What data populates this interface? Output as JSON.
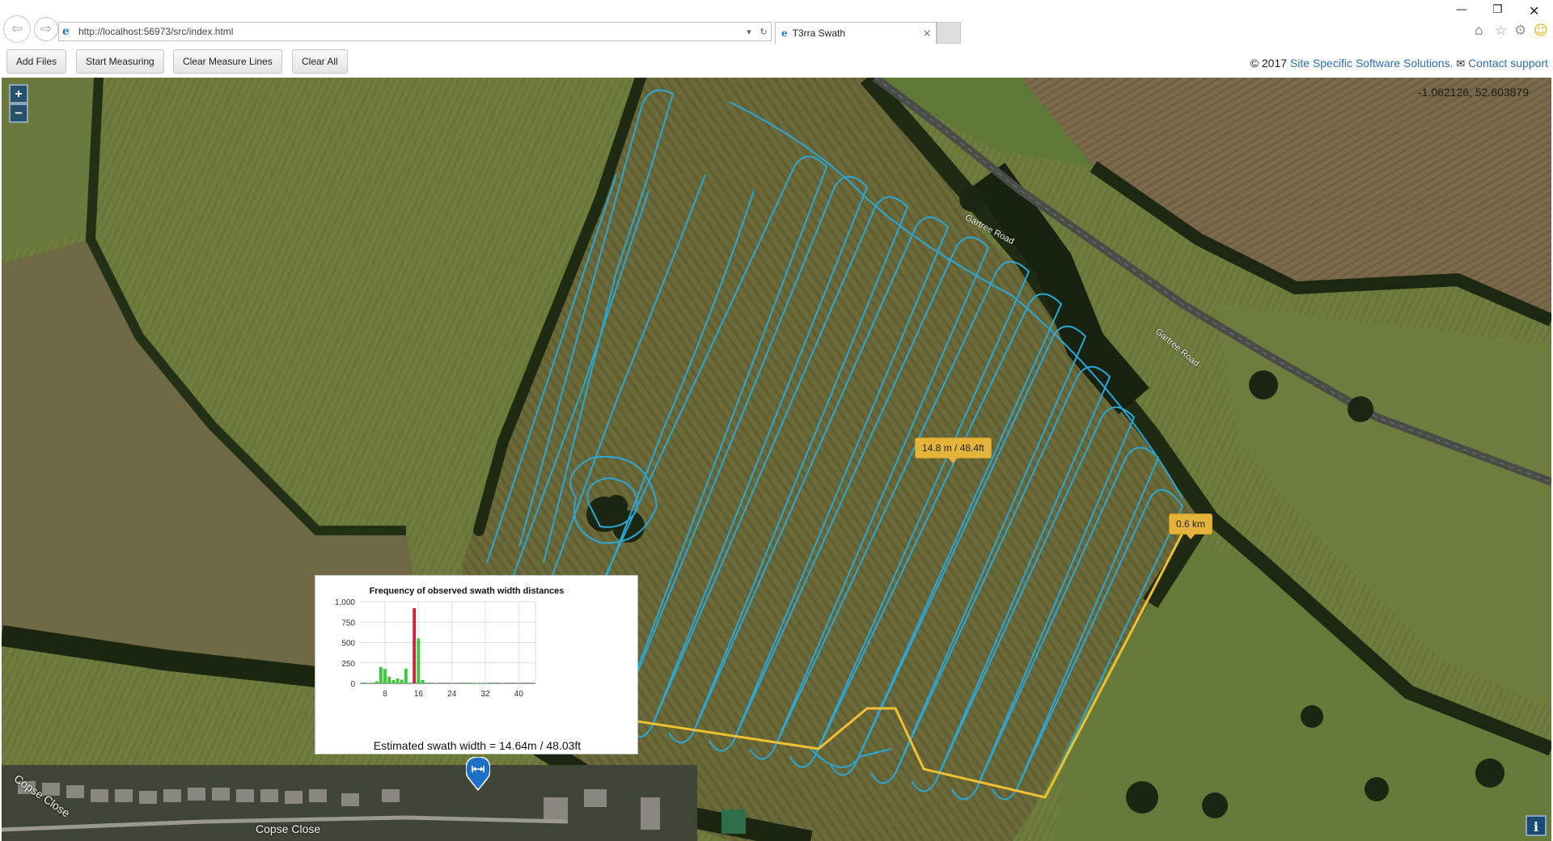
{
  "browser": {
    "url": "http://localhost:56973/src/index.html",
    "tab_title": "T3rra Swath",
    "close_tab": "×",
    "back_icon": "arrow-left-icon",
    "forward_icon": "arrow-right-icon"
  },
  "toolbar": {
    "add_files": "Add Files",
    "start_measuring": "Start Measuring",
    "clear_measure_lines": "Clear Measure Lines",
    "clear_all": "Clear All"
  },
  "credits": {
    "copyright": "© 2017",
    "company": "Site Specific Software Solutions.",
    "contact": "Contact support"
  },
  "map": {
    "zoom_in": "+",
    "zoom_out": "−",
    "coordinates": "-1.062126, 52.603879",
    "measure_tooltip": "14.8 m / 48.4ft",
    "distance_tooltip": "0.6 km",
    "road_label_1": "Gartree Road",
    "road_label_2": "Gartree Road",
    "street_label_1": "Copse Close",
    "street_label_2": "Copse Close",
    "info_button": "i",
    "swath_color": "#2aa8d8",
    "measure_color": "#f0c030"
  },
  "chart_panel": {
    "estimate": "Estimated swath width = 14.64m / 48.03ft"
  },
  "chart_data": {
    "type": "bar",
    "title": "Frequency of observed swath width distances",
    "xlabel": "",
    "ylabel": "",
    "x_ticks": [
      8,
      16,
      24,
      32,
      40
    ],
    "y_ticks": [
      0,
      250,
      500,
      750,
      1000
    ],
    "y_tick_labels": [
      "0",
      "250",
      "500",
      "750",
      "1,000"
    ],
    "xlim": [
      2,
      44
    ],
    "ylim": [
      0,
      1000
    ],
    "grid": true,
    "bars": [
      {
        "x": 3,
        "value": 10,
        "color": "#33cc33"
      },
      {
        "x": 4,
        "value": 5,
        "color": "#33cc33"
      },
      {
        "x": 6,
        "value": 25,
        "color": "#33cc33"
      },
      {
        "x": 7,
        "value": 200,
        "color": "#33cc33"
      },
      {
        "x": 8,
        "value": 175,
        "color": "#33cc33"
      },
      {
        "x": 9,
        "value": 80,
        "color": "#33cc33"
      },
      {
        "x": 10,
        "value": 40,
        "color": "#33cc33"
      },
      {
        "x": 11,
        "value": 60,
        "color": "#33cc33"
      },
      {
        "x": 12,
        "value": 45,
        "color": "#33cc33"
      },
      {
        "x": 13,
        "value": 180,
        "color": "#33cc33"
      },
      {
        "x": 14,
        "value": 10,
        "color": "#33cc33"
      },
      {
        "x": 15,
        "value": 920,
        "color": "#d0213f"
      },
      {
        "x": 16,
        "value": 550,
        "color": "#33cc33"
      },
      {
        "x": 17,
        "value": 40,
        "color": "#33cc33"
      },
      {
        "x": 18,
        "value": 8,
        "color": "#33cc33"
      },
      {
        "x": 20,
        "value": 5,
        "color": "#33cc33"
      },
      {
        "x": 29,
        "value": 6,
        "color": "#33cc33"
      },
      {
        "x": 30,
        "value": 5,
        "color": "#33cc33"
      },
      {
        "x": 31,
        "value": 6,
        "color": "#33cc33"
      },
      {
        "x": 32,
        "value": 5,
        "color": "#33cc33"
      },
      {
        "x": 36,
        "value": 4,
        "color": "#33cc33"
      }
    ]
  }
}
